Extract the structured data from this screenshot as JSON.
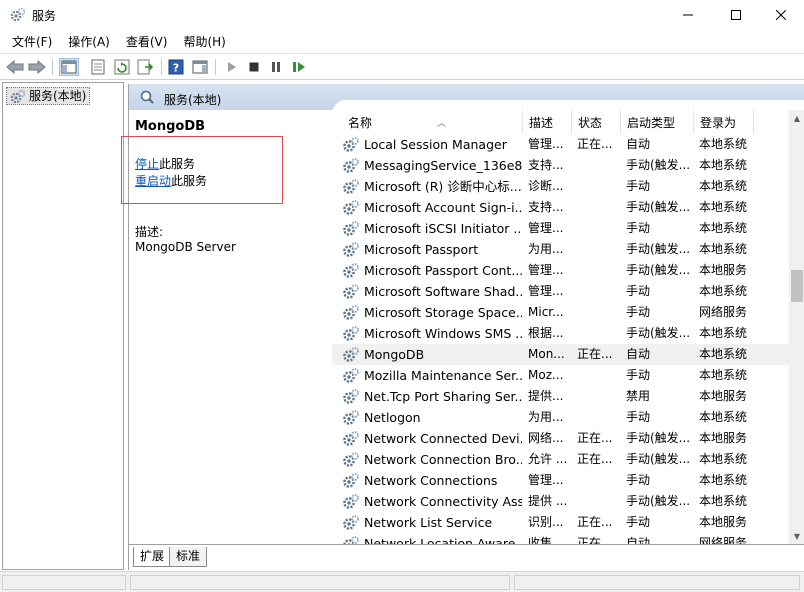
{
  "window": {
    "title": "服务"
  },
  "menu": [
    "文件(F)",
    "操作(A)",
    "查看(V)",
    "帮助(H)"
  ],
  "tree": {
    "root": "服务(本地)"
  },
  "main_header": {
    "title": "服务(本地)"
  },
  "details": {
    "service_name": "MongoDB",
    "action_stop_link": "停止",
    "action_stop_suffix": "此服务",
    "action_restart_link": "重启动",
    "action_restart_suffix": "此服务",
    "description_label": "描述:",
    "description_value": "MongoDB Server"
  },
  "columns": [
    "名称",
    "描述",
    "状态",
    "启动类型",
    "登录为"
  ],
  "rows": [
    {
      "name": "Local Session Manager",
      "desc": "管理...",
      "status": "正在...",
      "start": "自动",
      "logon": "本地系统"
    },
    {
      "name": "MessagingService_136e8...",
      "desc": "支持...",
      "status": "",
      "start": "手动(触发...",
      "logon": "本地系统"
    },
    {
      "name": "Microsoft (R) 诊断中心标...",
      "desc": "诊断...",
      "status": "",
      "start": "手动",
      "logon": "本地系统"
    },
    {
      "name": "Microsoft Account Sign-i...",
      "desc": "支持...",
      "status": "",
      "start": "手动(触发...",
      "logon": "本地系统"
    },
    {
      "name": "Microsoft iSCSI Initiator ...",
      "desc": "管理...",
      "status": "",
      "start": "手动",
      "logon": "本地系统"
    },
    {
      "name": "Microsoft Passport",
      "desc": "为用...",
      "status": "",
      "start": "手动(触发...",
      "logon": "本地系统"
    },
    {
      "name": "Microsoft Passport Cont...",
      "desc": "管理...",
      "status": "",
      "start": "手动(触发...",
      "logon": "本地服务"
    },
    {
      "name": "Microsoft Software Shad...",
      "desc": "管理...",
      "status": "",
      "start": "手动",
      "logon": "本地系统"
    },
    {
      "name": "Microsoft Storage Space...",
      "desc": "Micr...",
      "status": "",
      "start": "手动",
      "logon": "网络服务"
    },
    {
      "name": "Microsoft Windows SMS ...",
      "desc": "根据...",
      "status": "",
      "start": "手动(触发...",
      "logon": "本地系统"
    },
    {
      "name": "MongoDB",
      "desc": "Mon...",
      "status": "正在...",
      "start": "自动",
      "logon": "本地系统"
    },
    {
      "name": "Mozilla Maintenance Ser...",
      "desc": "Moz...",
      "status": "",
      "start": "手动",
      "logon": "本地系统"
    },
    {
      "name": "Net.Tcp Port Sharing Ser...",
      "desc": "提供...",
      "status": "",
      "start": "禁用",
      "logon": "本地服务"
    },
    {
      "name": "Netlogon",
      "desc": "为用...",
      "status": "",
      "start": "手动",
      "logon": "本地系统"
    },
    {
      "name": "Network Connected Devi...",
      "desc": "网络...",
      "status": "正在...",
      "start": "手动(触发...",
      "logon": "本地服务"
    },
    {
      "name": "Network Connection Bro...",
      "desc": "允许 ...",
      "status": "正在...",
      "start": "手动(触发...",
      "logon": "本地系统"
    },
    {
      "name": "Network Connections",
      "desc": "管理...",
      "status": "",
      "start": "手动",
      "logon": "本地系统"
    },
    {
      "name": "Network Connectivity Ass...",
      "desc": "提供 ...",
      "status": "",
      "start": "手动(触发...",
      "logon": "本地系统"
    },
    {
      "name": "Network List Service",
      "desc": "识别...",
      "status": "正在...",
      "start": "手动",
      "logon": "本地服务"
    },
    {
      "name": "Network Location Aware...",
      "desc": "收集...",
      "status": "正在...",
      "start": "自动",
      "logon": "网络服务"
    }
  ],
  "tabs": [
    "扩展",
    "标准"
  ],
  "colors": {
    "link": "#0a55c0",
    "highlight_box": "#e04a4a",
    "header_band": "#c5d5e8",
    "selected_row": "#f0f0f0"
  }
}
